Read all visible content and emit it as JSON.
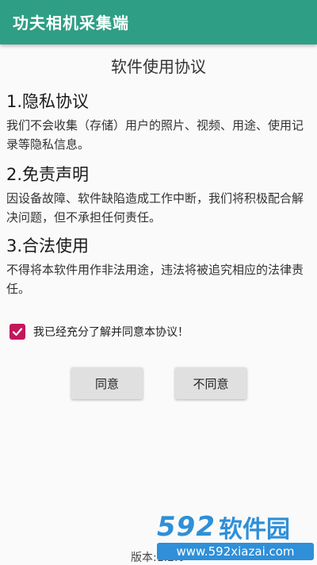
{
  "appbar": {
    "title": "功夫相机采集端"
  },
  "agreement": {
    "title": "软件使用协议",
    "sections": [
      {
        "heading": "1.隐私协议",
        "body": "我们不会收集（存储）用户的照片、视频、用途、使用记录等隐私信息。"
      },
      {
        "heading": "2.免责声明",
        "body": "因设备故障、软件缺陷造成工作中断，我们将积极配合解决问题，但不承担任何责任。"
      },
      {
        "heading": "3.合法使用",
        "body": "不得将本软件用作非法用途，违法将被追究相应的法律责任。"
      }
    ]
  },
  "consent": {
    "label": "我已经充分了解并同意本协议！",
    "checked": true,
    "color": "#c2185b"
  },
  "buttons": {
    "agree": "同意",
    "disagree": "不同意"
  },
  "footer": {
    "version": "版本:1.2.0"
  },
  "watermark": {
    "brand_number": "592",
    "brand_text": "软件园",
    "url": "www.592xiazai.com"
  },
  "colors": {
    "primary": "#2e9e84",
    "accent": "#c2185b"
  }
}
